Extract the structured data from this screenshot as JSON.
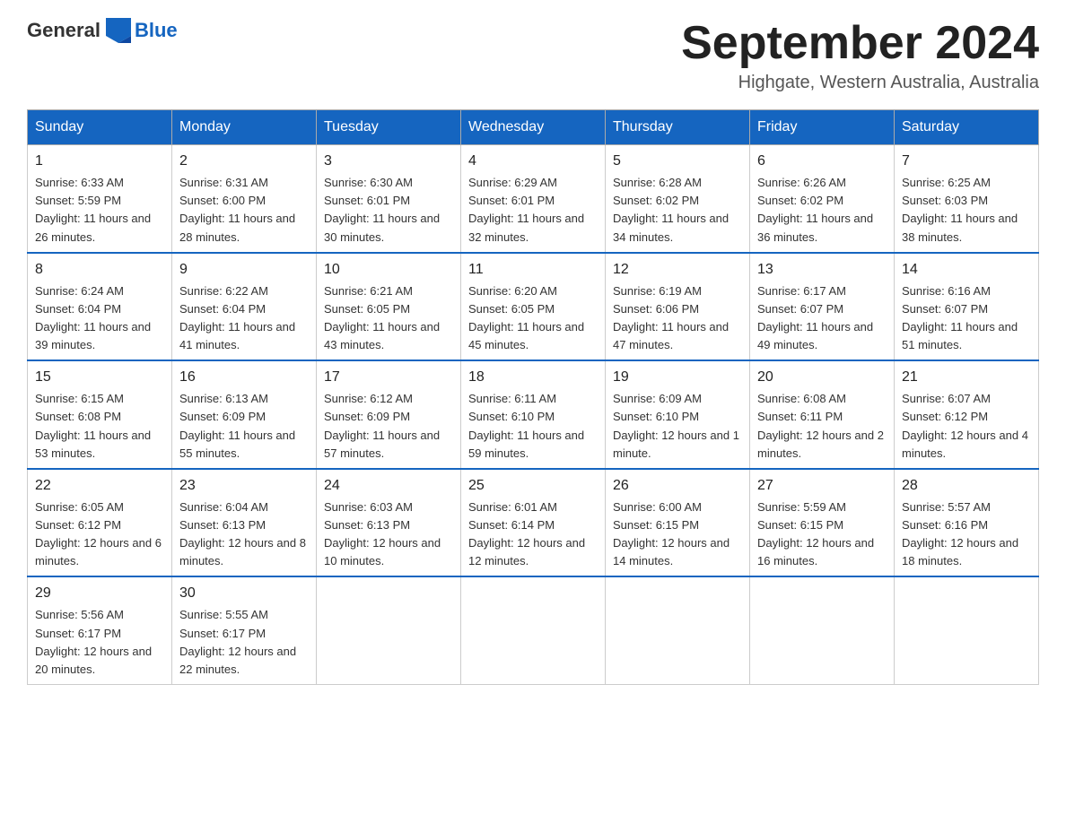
{
  "header": {
    "logo_general": "General",
    "logo_blue": "Blue",
    "month_year": "September 2024",
    "location": "Highgate, Western Australia, Australia"
  },
  "days_of_week": [
    "Sunday",
    "Monday",
    "Tuesday",
    "Wednesday",
    "Thursday",
    "Friday",
    "Saturday"
  ],
  "weeks": [
    [
      {
        "day": "1",
        "sunrise": "6:33 AM",
        "sunset": "5:59 PM",
        "daylight": "11 hours and 26 minutes."
      },
      {
        "day": "2",
        "sunrise": "6:31 AM",
        "sunset": "6:00 PM",
        "daylight": "11 hours and 28 minutes."
      },
      {
        "day": "3",
        "sunrise": "6:30 AM",
        "sunset": "6:01 PM",
        "daylight": "11 hours and 30 minutes."
      },
      {
        "day": "4",
        "sunrise": "6:29 AM",
        "sunset": "6:01 PM",
        "daylight": "11 hours and 32 minutes."
      },
      {
        "day": "5",
        "sunrise": "6:28 AM",
        "sunset": "6:02 PM",
        "daylight": "11 hours and 34 minutes."
      },
      {
        "day": "6",
        "sunrise": "6:26 AM",
        "sunset": "6:02 PM",
        "daylight": "11 hours and 36 minutes."
      },
      {
        "day": "7",
        "sunrise": "6:25 AM",
        "sunset": "6:03 PM",
        "daylight": "11 hours and 38 minutes."
      }
    ],
    [
      {
        "day": "8",
        "sunrise": "6:24 AM",
        "sunset": "6:04 PM",
        "daylight": "11 hours and 39 minutes."
      },
      {
        "day": "9",
        "sunrise": "6:22 AM",
        "sunset": "6:04 PM",
        "daylight": "11 hours and 41 minutes."
      },
      {
        "day": "10",
        "sunrise": "6:21 AM",
        "sunset": "6:05 PM",
        "daylight": "11 hours and 43 minutes."
      },
      {
        "day": "11",
        "sunrise": "6:20 AM",
        "sunset": "6:05 PM",
        "daylight": "11 hours and 45 minutes."
      },
      {
        "day": "12",
        "sunrise": "6:19 AM",
        "sunset": "6:06 PM",
        "daylight": "11 hours and 47 minutes."
      },
      {
        "day": "13",
        "sunrise": "6:17 AM",
        "sunset": "6:07 PM",
        "daylight": "11 hours and 49 minutes."
      },
      {
        "day": "14",
        "sunrise": "6:16 AM",
        "sunset": "6:07 PM",
        "daylight": "11 hours and 51 minutes."
      }
    ],
    [
      {
        "day": "15",
        "sunrise": "6:15 AM",
        "sunset": "6:08 PM",
        "daylight": "11 hours and 53 minutes."
      },
      {
        "day": "16",
        "sunrise": "6:13 AM",
        "sunset": "6:09 PM",
        "daylight": "11 hours and 55 minutes."
      },
      {
        "day": "17",
        "sunrise": "6:12 AM",
        "sunset": "6:09 PM",
        "daylight": "11 hours and 57 minutes."
      },
      {
        "day": "18",
        "sunrise": "6:11 AM",
        "sunset": "6:10 PM",
        "daylight": "11 hours and 59 minutes."
      },
      {
        "day": "19",
        "sunrise": "6:09 AM",
        "sunset": "6:10 PM",
        "daylight": "12 hours and 1 minute."
      },
      {
        "day": "20",
        "sunrise": "6:08 AM",
        "sunset": "6:11 PM",
        "daylight": "12 hours and 2 minutes."
      },
      {
        "day": "21",
        "sunrise": "6:07 AM",
        "sunset": "6:12 PM",
        "daylight": "12 hours and 4 minutes."
      }
    ],
    [
      {
        "day": "22",
        "sunrise": "6:05 AM",
        "sunset": "6:12 PM",
        "daylight": "12 hours and 6 minutes."
      },
      {
        "day": "23",
        "sunrise": "6:04 AM",
        "sunset": "6:13 PM",
        "daylight": "12 hours and 8 minutes."
      },
      {
        "day": "24",
        "sunrise": "6:03 AM",
        "sunset": "6:13 PM",
        "daylight": "12 hours and 10 minutes."
      },
      {
        "day": "25",
        "sunrise": "6:01 AM",
        "sunset": "6:14 PM",
        "daylight": "12 hours and 12 minutes."
      },
      {
        "day": "26",
        "sunrise": "6:00 AM",
        "sunset": "6:15 PM",
        "daylight": "12 hours and 14 minutes."
      },
      {
        "day": "27",
        "sunrise": "5:59 AM",
        "sunset": "6:15 PM",
        "daylight": "12 hours and 16 minutes."
      },
      {
        "day": "28",
        "sunrise": "5:57 AM",
        "sunset": "6:16 PM",
        "daylight": "12 hours and 18 minutes."
      }
    ],
    [
      {
        "day": "29",
        "sunrise": "5:56 AM",
        "sunset": "6:17 PM",
        "daylight": "12 hours and 20 minutes."
      },
      {
        "day": "30",
        "sunrise": "5:55 AM",
        "sunset": "6:17 PM",
        "daylight": "12 hours and 22 minutes."
      },
      null,
      null,
      null,
      null,
      null
    ]
  ],
  "labels": {
    "sunrise": "Sunrise:",
    "sunset": "Sunset:",
    "daylight": "Daylight:"
  }
}
